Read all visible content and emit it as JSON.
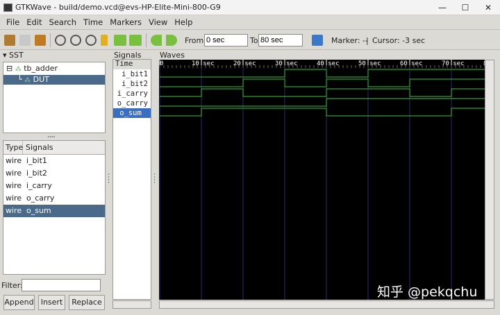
{
  "window": {
    "title": "GTKWave - build/demo.vcd@evs-HP-Elite-Mini-800-G9",
    "minimize": "—",
    "maximize": "☐",
    "close": "✕"
  },
  "menu": [
    "File",
    "Edit",
    "Search",
    "Time",
    "Markers",
    "View",
    "Help"
  ],
  "toolbar": {
    "from_label": "From:",
    "from_value": "0 sec",
    "to_label": "To:",
    "to_value": "80 sec",
    "marker": "Marker: --",
    "sep": "|",
    "cursor": "Cursor: -3 sec"
  },
  "sst": {
    "title": "SST",
    "tree": [
      "tb_adder",
      "DUT"
    ],
    "columns": [
      "Type",
      "Signals"
    ],
    "signals": [
      {
        "type": "wire",
        "name": "i_bit1"
      },
      {
        "type": "wire",
        "name": "i_bit2"
      },
      {
        "type": "wire",
        "name": "i_carry"
      },
      {
        "type": "wire",
        "name": "o_carry"
      },
      {
        "type": "wire",
        "name": "o_sum"
      }
    ],
    "filter_label": "Filter:",
    "filter_value": "",
    "buttons": [
      "Append",
      "Insert",
      "Replace"
    ]
  },
  "signals_panel": {
    "title": "Signals",
    "header": "Time",
    "items": [
      "i_bit1",
      "i_bit2",
      "i_carry",
      "o_carry",
      "o_sum"
    ]
  },
  "waves_panel": {
    "title": "Waves",
    "ticks": [
      "0",
      "10 sec",
      "20 sec",
      "30 sec",
      "40 sec",
      "50 sec",
      "60 sec",
      "70 sec",
      "8"
    ]
  },
  "waveforms": {
    "step": 10,
    "i_bit1": [
      0,
      0,
      0,
      1,
      0,
      1,
      1,
      1
    ],
    "i_bit2": [
      0,
      0,
      1,
      0,
      1,
      0,
      1,
      1
    ],
    "i_carry": [
      0,
      1,
      0,
      0,
      1,
      1,
      0,
      1
    ],
    "o_carry": [
      0,
      0,
      0,
      0,
      1,
      1,
      1,
      1
    ],
    "o_sum": [
      0,
      1,
      1,
      1,
      0,
      0,
      0,
      1
    ]
  },
  "colors": {
    "wave": "#3fbf3f",
    "grid": "#2a2a6a",
    "selected": "#4b6a8a"
  },
  "watermark": "知乎 @pekqchu"
}
